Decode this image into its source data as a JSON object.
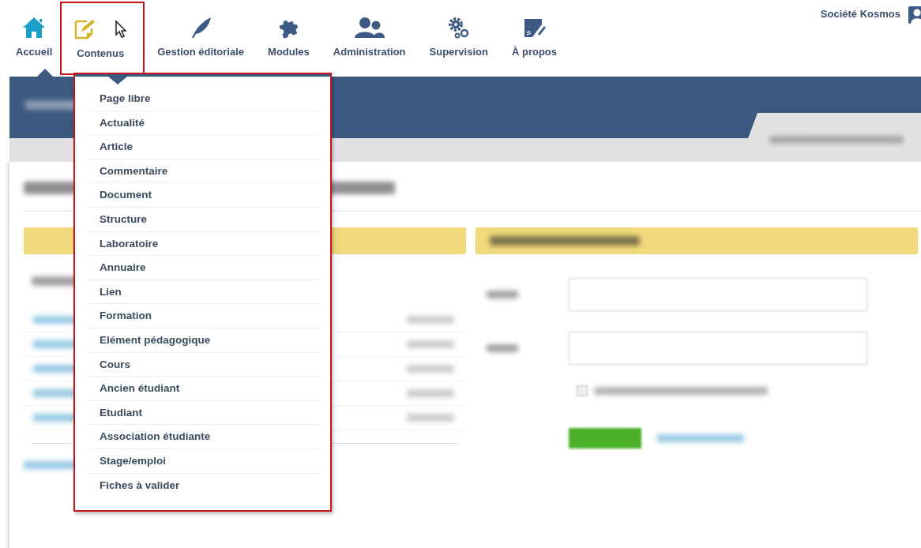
{
  "nav": [
    {
      "label": "Accueil",
      "selected": true,
      "highlighted": false
    },
    {
      "label": "Contenus",
      "selected": false,
      "highlighted": true
    },
    {
      "label": "Gestion éditoriale",
      "selected": false,
      "highlighted": false
    },
    {
      "label": "Modules",
      "selected": false,
      "highlighted": false
    },
    {
      "label": "Administration",
      "selected": false,
      "highlighted": false
    },
    {
      "label": "Supervision",
      "selected": false,
      "highlighted": false
    },
    {
      "label": "À propos",
      "selected": false,
      "highlighted": false
    }
  ],
  "user": {
    "name": "Société Kosmos"
  },
  "search_form": {
    "checkbox": {
      "checked": false
    }
  },
  "dropdown": {
    "highlighted": true,
    "items": [
      "Page libre",
      "Actualité",
      "Article",
      "Commentaire",
      "Document",
      "Structure",
      "Laboratoire",
      "Annuaire",
      "Lien",
      "Formation",
      "Elément pédagogique",
      "Cours",
      "Ancien étudiant",
      "Etudiant",
      "Association étudiante",
      "Stage/emploi",
      "Fiches à valider"
    ]
  }
}
